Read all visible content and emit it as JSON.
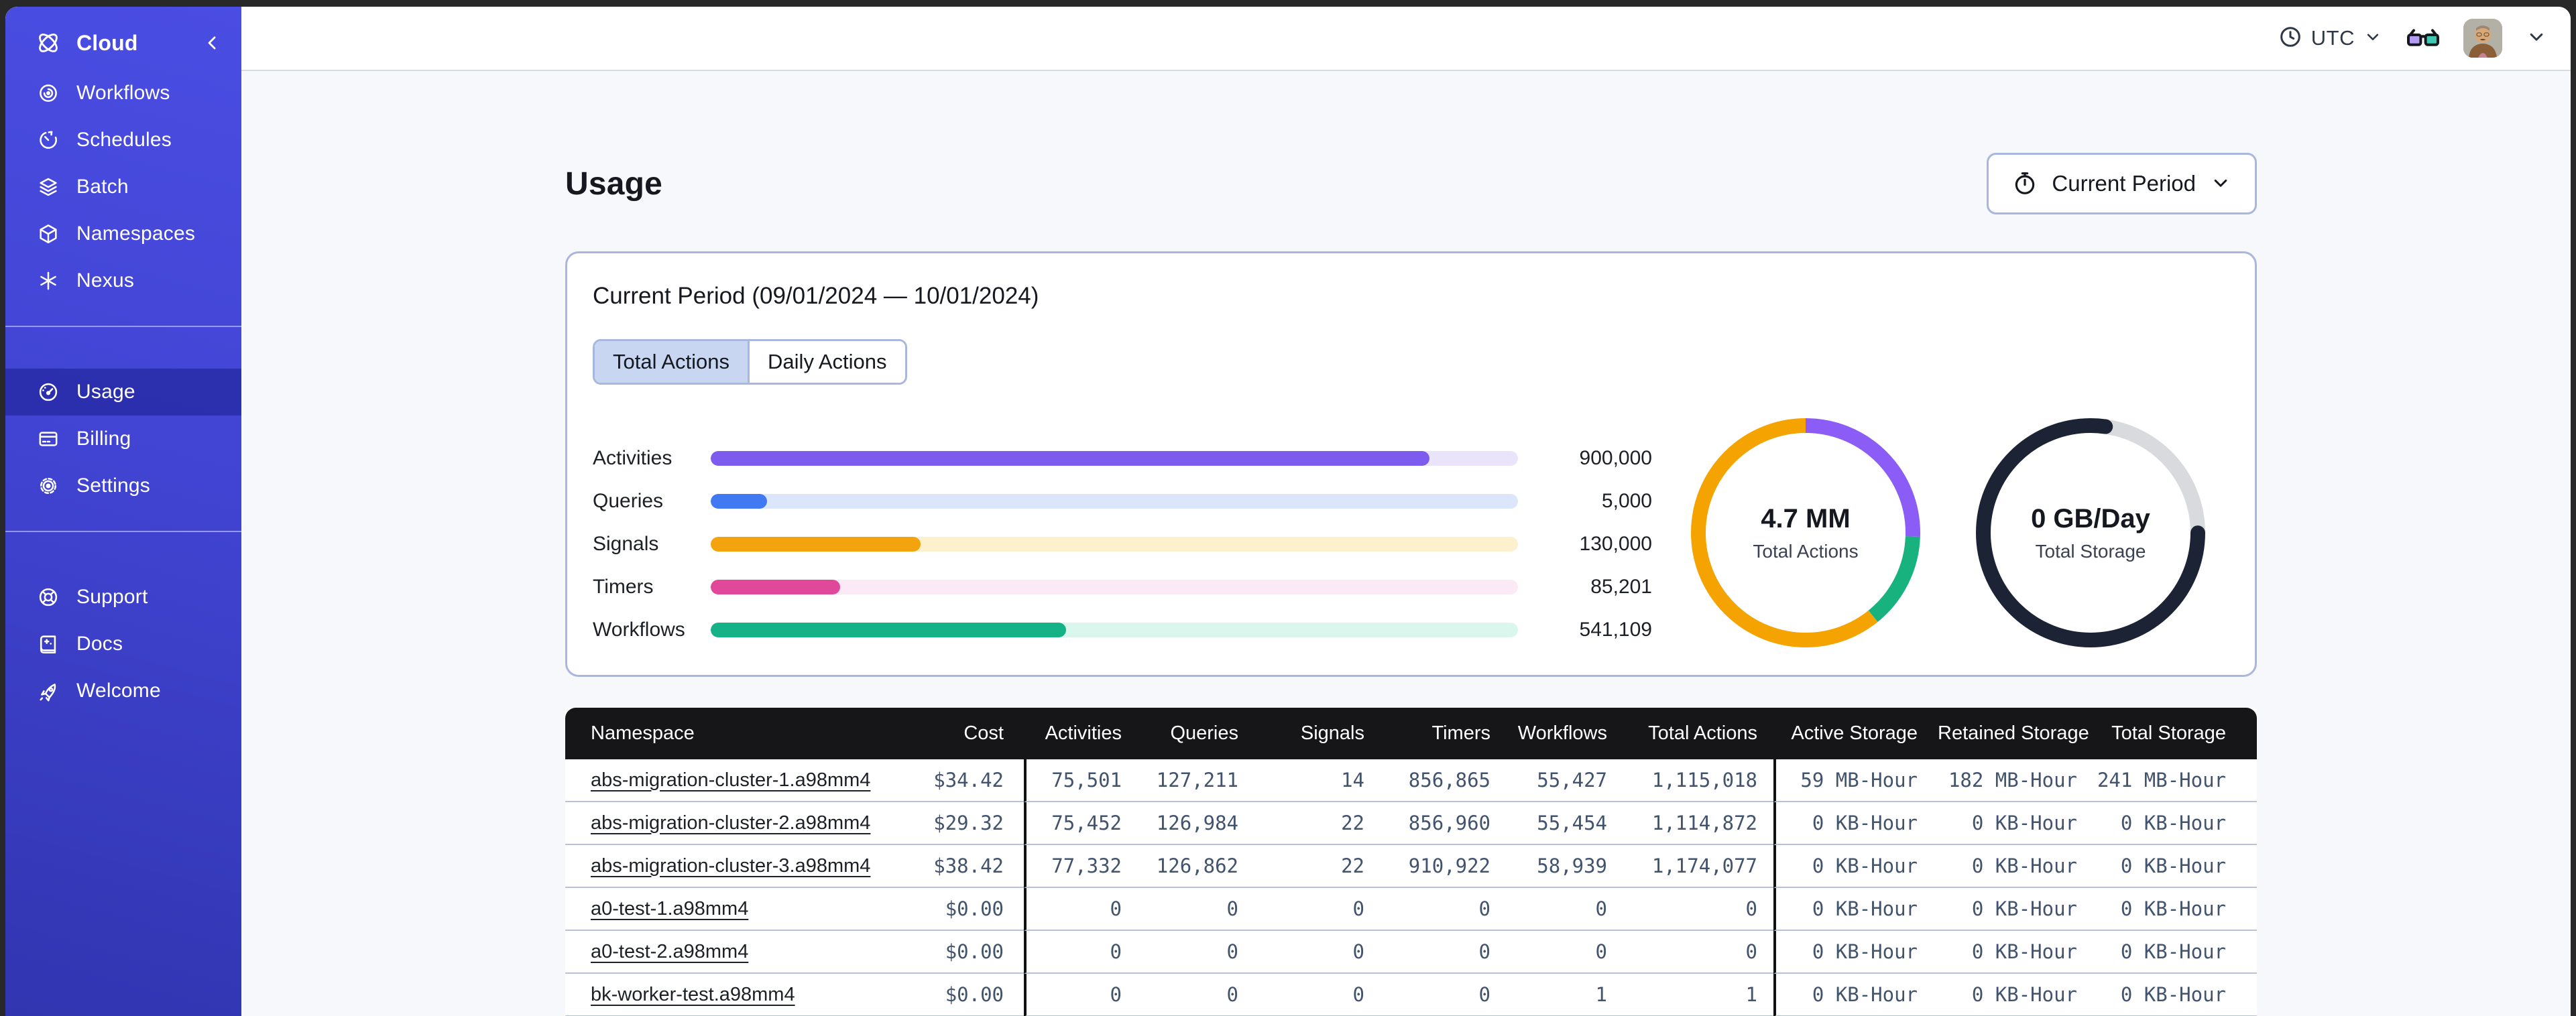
{
  "sidebar": {
    "brand": {
      "label": "Cloud",
      "icon": "temporal-logo"
    },
    "groups": [
      [
        {
          "icon": "workflows-icon",
          "label": "Workflows",
          "active": false
        },
        {
          "icon": "schedules-icon",
          "label": "Schedules",
          "active": false
        },
        {
          "icon": "batch-icon",
          "label": "Batch",
          "active": false
        },
        {
          "icon": "namespaces-icon",
          "label": "Namespaces",
          "active": false
        },
        {
          "icon": "nexus-icon",
          "label": "Nexus",
          "active": false
        }
      ],
      [
        {
          "icon": "usage-icon",
          "label": "Usage",
          "active": true
        },
        {
          "icon": "billing-icon",
          "label": "Billing",
          "active": false
        },
        {
          "icon": "settings-icon",
          "label": "Settings",
          "active": false
        }
      ],
      [
        {
          "icon": "support-icon",
          "label": "Support",
          "active": false
        },
        {
          "icon": "docs-icon",
          "label": "Docs",
          "active": false
        },
        {
          "icon": "welcome-icon",
          "label": "Welcome",
          "active": false
        }
      ]
    ]
  },
  "topbar": {
    "timezone_label": "UTC"
  },
  "page": {
    "title": "Usage",
    "period_button_label": "Current Period"
  },
  "card": {
    "title": "Current Period (09/01/2024 — 10/01/2024)",
    "tabs": [
      {
        "label": "Total Actions",
        "selected": true
      },
      {
        "label": "Daily Actions",
        "selected": false
      }
    ]
  },
  "chart_data": [
    {
      "type": "bar",
      "orientation": "horizontal",
      "rows": [
        {
          "label": "Activities",
          "value": 900000,
          "value_label": "900,000",
          "fill_pct": 89,
          "color": "#7e5bef",
          "track_color": "#eae4fb"
        },
        {
          "label": "Queries",
          "value": 5000,
          "value_label": "5,000",
          "fill_pct": 7,
          "color": "#4179f2",
          "track_color": "#dbe6fb"
        },
        {
          "label": "Signals",
          "value": 130000,
          "value_label": "130,000",
          "fill_pct": 26,
          "color": "#f2a30d",
          "track_color": "#fcf0cd"
        },
        {
          "label": "Timers",
          "value": 85201,
          "value_label": "85,201",
          "fill_pct": 16,
          "color": "#e0489a",
          "track_color": "#fce9f6"
        },
        {
          "label": "Workflows",
          "value": 541109,
          "value_label": "541,109",
          "fill_pct": 44,
          "color": "#16b287",
          "track_color": "#d9f7ec"
        }
      ]
    },
    {
      "type": "donut",
      "name": "total-actions-donut",
      "center_value": "4.7 MM",
      "center_label": "Total Actions",
      "segments": [
        {
          "color": "#8b5cf6",
          "start_deg": 0,
          "sweep_deg": 92,
          "pct": 25.6,
          "round_caps": false
        },
        {
          "color": "#17b27e",
          "start_deg": 92,
          "sweep_deg": 49,
          "pct": 13.6,
          "round_caps": false
        },
        {
          "color": "#f5a300",
          "start_deg": 141,
          "sweep_deg": 219,
          "pct": 60.8,
          "round_caps": false
        }
      ]
    },
    {
      "type": "donut",
      "name": "total-storage-donut",
      "center_value": "0 GB/Day",
      "center_label": "Total Storage",
      "segments": [
        {
          "color": "#d8dade",
          "start_deg": 8,
          "sweep_deg": 82,
          "pct": 22.8,
          "round_caps": false
        },
        {
          "color": "#1b2334",
          "start_deg": 90,
          "sweep_deg": 278,
          "pct": 77.2,
          "round_caps": true
        }
      ]
    }
  ],
  "table": {
    "headers": [
      "Namespace",
      "Cost",
      "Activities",
      "Queries",
      "Signals",
      "Timers",
      "Workflows",
      "Total Actions",
      "Active Storage",
      "Retained Storage",
      "Total Storage"
    ],
    "rows": [
      [
        "abs-migration-cluster-1.a98mm4",
        "$34.42",
        "75,501",
        "127,211",
        "14",
        "856,865",
        "55,427",
        "1,115,018",
        "59 MB-Hour",
        "182 MB-Hour",
        "241 MB-Hour"
      ],
      [
        "abs-migration-cluster-2.a98mm4",
        "$29.32",
        "75,452",
        "126,984",
        "22",
        "856,960",
        "55,454",
        "1,114,872",
        "0 KB-Hour",
        "0 KB-Hour",
        "0 KB-Hour"
      ],
      [
        "abs-migration-cluster-3.a98mm4",
        "$38.42",
        "77,332",
        "126,862",
        "22",
        "910,922",
        "58,939",
        "1,174,077",
        "0 KB-Hour",
        "0 KB-Hour",
        "0 KB-Hour"
      ],
      [
        "a0-test-1.a98mm4",
        "$0.00",
        "0",
        "0",
        "0",
        "0",
        "0",
        "0",
        "0 KB-Hour",
        "0 KB-Hour",
        "0 KB-Hour"
      ],
      [
        "a0-test-2.a98mm4",
        "$0.00",
        "0",
        "0",
        "0",
        "0",
        "0",
        "0",
        "0 KB-Hour",
        "0 KB-Hour",
        "0 KB-Hour"
      ],
      [
        "bk-worker-test.a98mm4",
        "$0.00",
        "0",
        "0",
        "0",
        "0",
        "1",
        "1",
        "0 KB-Hour",
        "0 KB-Hour",
        "0 KB-Hour"
      ]
    ]
  }
}
